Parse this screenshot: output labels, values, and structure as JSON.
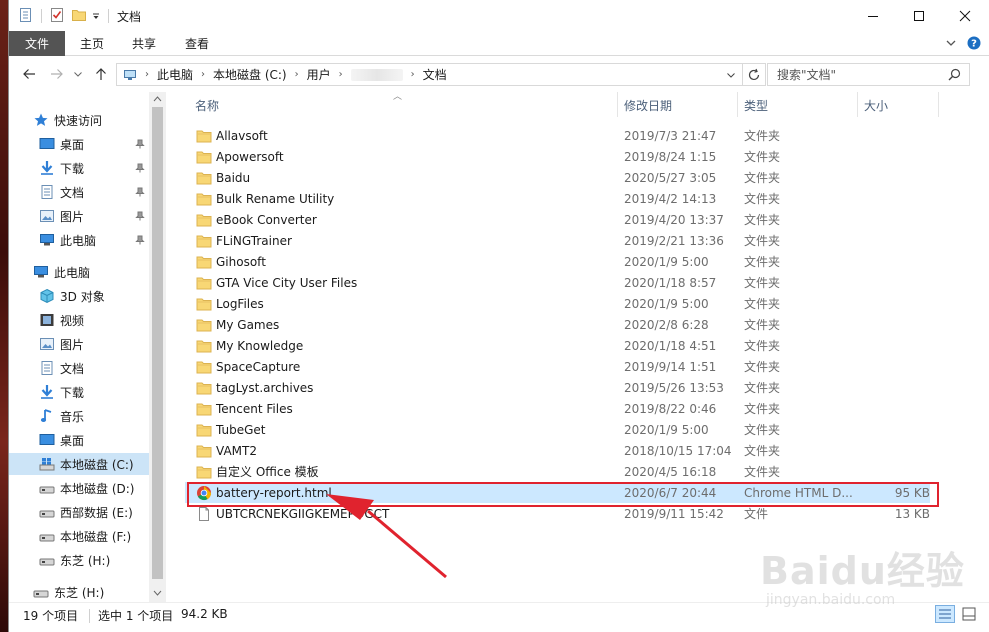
{
  "window": {
    "title": "文档",
    "controls": {
      "minimize": "minimize",
      "maximize": "maximize",
      "close": "close"
    }
  },
  "ribbon": {
    "file_tab": "文件",
    "tabs": [
      "主页",
      "共享",
      "查看"
    ]
  },
  "address": {
    "crumbs": [
      "此电脑",
      "本地磁盘 (C:)",
      "用户",
      "文档"
    ],
    "search_placeholder": "搜索\"文档\""
  },
  "nav": {
    "quick_access": "快速访问",
    "pinned": [
      "桌面",
      "下载",
      "文档",
      "图片",
      "此电脑"
    ],
    "this_pc": "此电脑",
    "pc_items": [
      "3D 对象",
      "视频",
      "图片",
      "文档",
      "下载",
      "音乐",
      "桌面"
    ],
    "drives": [
      "本地磁盘 (C:)",
      "本地磁盘 (D:)",
      "西部数据 (E:)",
      "本地磁盘 (F:)",
      "东芝 (H:)"
    ],
    "bottom_item": "东芝 (H:)"
  },
  "columns": {
    "name": "名称",
    "date": "修改日期",
    "type": "类型",
    "size": "大小"
  },
  "files": [
    {
      "name": "Allavsoft",
      "date": "2019/7/3 21:47",
      "type": "文件夹",
      "size": "",
      "kind": "folder"
    },
    {
      "name": "Apowersoft",
      "date": "2019/8/24 1:15",
      "type": "文件夹",
      "size": "",
      "kind": "folder"
    },
    {
      "name": "Baidu",
      "date": "2020/5/27 3:05",
      "type": "文件夹",
      "size": "",
      "kind": "folder"
    },
    {
      "name": "Bulk Rename Utility",
      "date": "2019/4/2 14:13",
      "type": "文件夹",
      "size": "",
      "kind": "folder"
    },
    {
      "name": "eBook Converter",
      "date": "2019/4/20 13:37",
      "type": "文件夹",
      "size": "",
      "kind": "folder"
    },
    {
      "name": "FLiNGTrainer",
      "date": "2019/2/21 13:36",
      "type": "文件夹",
      "size": "",
      "kind": "folder"
    },
    {
      "name": "Gihosoft",
      "date": "2020/1/9 5:00",
      "type": "文件夹",
      "size": "",
      "kind": "folder"
    },
    {
      "name": "GTA Vice City User Files",
      "date": "2020/1/18 8:57",
      "type": "文件夹",
      "size": "",
      "kind": "folder"
    },
    {
      "name": "LogFiles",
      "date": "2020/1/9 5:00",
      "type": "文件夹",
      "size": "",
      "kind": "folder"
    },
    {
      "name": "My Games",
      "date": "2020/2/8 6:28",
      "type": "文件夹",
      "size": "",
      "kind": "folder"
    },
    {
      "name": "My Knowledge",
      "date": "2020/1/18 4:51",
      "type": "文件夹",
      "size": "",
      "kind": "folder"
    },
    {
      "name": "SpaceCapture",
      "date": "2019/9/14 1:51",
      "type": "文件夹",
      "size": "",
      "kind": "folder"
    },
    {
      "name": "tagLyst.archives",
      "date": "2019/5/26 13:53",
      "type": "文件夹",
      "size": "",
      "kind": "folder"
    },
    {
      "name": "Tencent Files",
      "date": "2019/8/22 0:46",
      "type": "文件夹",
      "size": "",
      "kind": "folder"
    },
    {
      "name": "TubeGet",
      "date": "2020/1/9 5:00",
      "type": "文件夹",
      "size": "",
      "kind": "folder"
    },
    {
      "name": "VAMT2",
      "date": "2018/10/15 17:04",
      "type": "文件夹",
      "size": "",
      "kind": "folder"
    },
    {
      "name": "自定义 Office 模板",
      "date": "2020/4/5 16:18",
      "type": "文件夹",
      "size": "",
      "kind": "folder"
    },
    {
      "name": "battery-report.html",
      "date": "2020/6/7 20:44",
      "type": "Chrome HTML D...",
      "size": "95 KB",
      "kind": "chrome"
    },
    {
      "name": "UBTCRCNEKGIIGKEMEPOGCT",
      "date": "2019/9/11 15:42",
      "type": "文件",
      "size": "13 KB",
      "kind": "file"
    }
  ],
  "selected_index": 17,
  "status": {
    "count": "19 个项目",
    "selection": "选中 1 个项目",
    "size": "94.2 KB"
  },
  "watermark": {
    "main": "Baidu经验",
    "sub": "jingyan.baidu.com"
  },
  "colors": {
    "selection": "#cce8ff",
    "highlight_box": "#e0232e",
    "file_tab": "#545454",
    "folder": "#f8d775"
  }
}
